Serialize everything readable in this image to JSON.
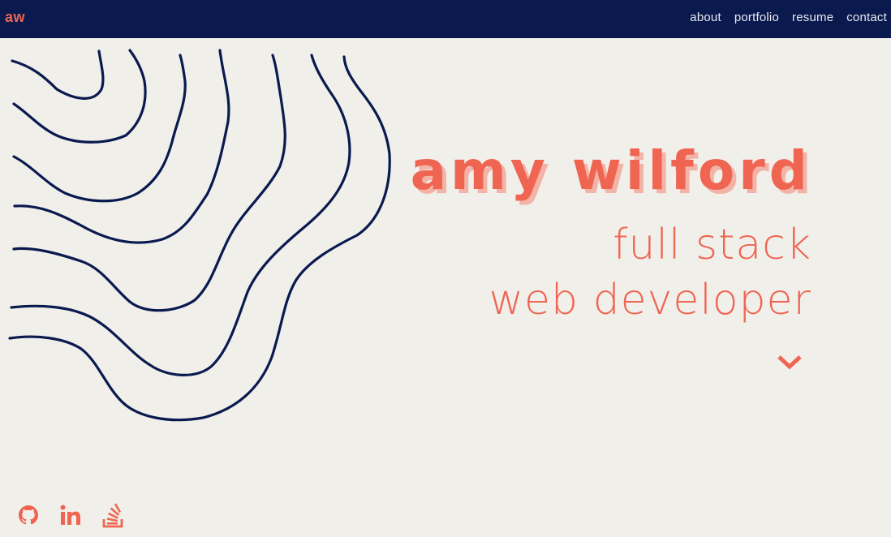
{
  "nav": {
    "brand": "aw",
    "links": [
      "about",
      "portfolio",
      "resume",
      "contact"
    ]
  },
  "hero": {
    "name": "amy wilford",
    "subtitle_line1": "full stack",
    "subtitle_line2": "web developer"
  },
  "icons": {
    "scroll": "chevron-down-icon",
    "social": [
      "github-icon",
      "linkedin-icon",
      "stackoverflow-icon"
    ]
  },
  "colors": {
    "navbar_bg": "#0a1a4f",
    "accent": "#ef6552",
    "accent_shadow": "#f3b3a7",
    "page_bg": "#f1efea",
    "line_color": "#0a1a4f",
    "nav_text": "#ebe9f0"
  }
}
